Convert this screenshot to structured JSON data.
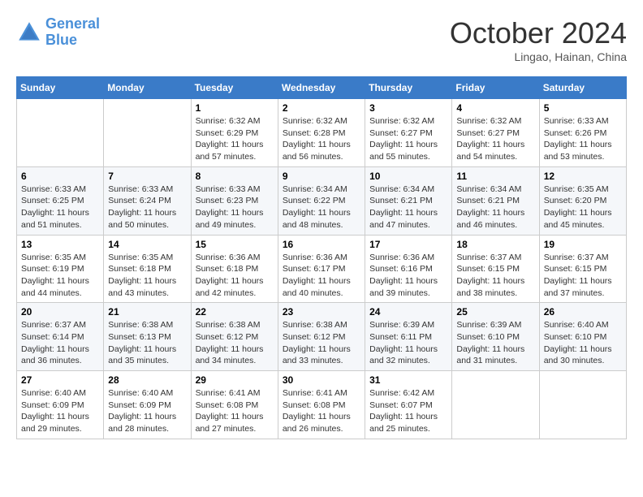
{
  "header": {
    "logo_line1": "General",
    "logo_line2": "Blue",
    "month": "October 2024",
    "location": "Lingao, Hainan, China"
  },
  "weekdays": [
    "Sunday",
    "Monday",
    "Tuesday",
    "Wednesday",
    "Thursday",
    "Friday",
    "Saturday"
  ],
  "weeks": [
    [
      {
        "day": "",
        "sunrise": "",
        "sunset": "",
        "daylight": ""
      },
      {
        "day": "",
        "sunrise": "",
        "sunset": "",
        "daylight": ""
      },
      {
        "day": "1",
        "sunrise": "Sunrise: 6:32 AM",
        "sunset": "Sunset: 6:29 PM",
        "daylight": "Daylight: 11 hours and 57 minutes."
      },
      {
        "day": "2",
        "sunrise": "Sunrise: 6:32 AM",
        "sunset": "Sunset: 6:28 PM",
        "daylight": "Daylight: 11 hours and 56 minutes."
      },
      {
        "day": "3",
        "sunrise": "Sunrise: 6:32 AM",
        "sunset": "Sunset: 6:27 PM",
        "daylight": "Daylight: 11 hours and 55 minutes."
      },
      {
        "day": "4",
        "sunrise": "Sunrise: 6:32 AM",
        "sunset": "Sunset: 6:27 PM",
        "daylight": "Daylight: 11 hours and 54 minutes."
      },
      {
        "day": "5",
        "sunrise": "Sunrise: 6:33 AM",
        "sunset": "Sunset: 6:26 PM",
        "daylight": "Daylight: 11 hours and 53 minutes."
      }
    ],
    [
      {
        "day": "6",
        "sunrise": "Sunrise: 6:33 AM",
        "sunset": "Sunset: 6:25 PM",
        "daylight": "Daylight: 11 hours and 51 minutes."
      },
      {
        "day": "7",
        "sunrise": "Sunrise: 6:33 AM",
        "sunset": "Sunset: 6:24 PM",
        "daylight": "Daylight: 11 hours and 50 minutes."
      },
      {
        "day": "8",
        "sunrise": "Sunrise: 6:33 AM",
        "sunset": "Sunset: 6:23 PM",
        "daylight": "Daylight: 11 hours and 49 minutes."
      },
      {
        "day": "9",
        "sunrise": "Sunrise: 6:34 AM",
        "sunset": "Sunset: 6:22 PM",
        "daylight": "Daylight: 11 hours and 48 minutes."
      },
      {
        "day": "10",
        "sunrise": "Sunrise: 6:34 AM",
        "sunset": "Sunset: 6:21 PM",
        "daylight": "Daylight: 11 hours and 47 minutes."
      },
      {
        "day": "11",
        "sunrise": "Sunrise: 6:34 AM",
        "sunset": "Sunset: 6:21 PM",
        "daylight": "Daylight: 11 hours and 46 minutes."
      },
      {
        "day": "12",
        "sunrise": "Sunrise: 6:35 AM",
        "sunset": "Sunset: 6:20 PM",
        "daylight": "Daylight: 11 hours and 45 minutes."
      }
    ],
    [
      {
        "day": "13",
        "sunrise": "Sunrise: 6:35 AM",
        "sunset": "Sunset: 6:19 PM",
        "daylight": "Daylight: 11 hours and 44 minutes."
      },
      {
        "day": "14",
        "sunrise": "Sunrise: 6:35 AM",
        "sunset": "Sunset: 6:18 PM",
        "daylight": "Daylight: 11 hours and 43 minutes."
      },
      {
        "day": "15",
        "sunrise": "Sunrise: 6:36 AM",
        "sunset": "Sunset: 6:18 PM",
        "daylight": "Daylight: 11 hours and 42 minutes."
      },
      {
        "day": "16",
        "sunrise": "Sunrise: 6:36 AM",
        "sunset": "Sunset: 6:17 PM",
        "daylight": "Daylight: 11 hours and 40 minutes."
      },
      {
        "day": "17",
        "sunrise": "Sunrise: 6:36 AM",
        "sunset": "Sunset: 6:16 PM",
        "daylight": "Daylight: 11 hours and 39 minutes."
      },
      {
        "day": "18",
        "sunrise": "Sunrise: 6:37 AM",
        "sunset": "Sunset: 6:15 PM",
        "daylight": "Daylight: 11 hours and 38 minutes."
      },
      {
        "day": "19",
        "sunrise": "Sunrise: 6:37 AM",
        "sunset": "Sunset: 6:15 PM",
        "daylight": "Daylight: 11 hours and 37 minutes."
      }
    ],
    [
      {
        "day": "20",
        "sunrise": "Sunrise: 6:37 AM",
        "sunset": "Sunset: 6:14 PM",
        "daylight": "Daylight: 11 hours and 36 minutes."
      },
      {
        "day": "21",
        "sunrise": "Sunrise: 6:38 AM",
        "sunset": "Sunset: 6:13 PM",
        "daylight": "Daylight: 11 hours and 35 minutes."
      },
      {
        "day": "22",
        "sunrise": "Sunrise: 6:38 AM",
        "sunset": "Sunset: 6:12 PM",
        "daylight": "Daylight: 11 hours and 34 minutes."
      },
      {
        "day": "23",
        "sunrise": "Sunrise: 6:38 AM",
        "sunset": "Sunset: 6:12 PM",
        "daylight": "Daylight: 11 hours and 33 minutes."
      },
      {
        "day": "24",
        "sunrise": "Sunrise: 6:39 AM",
        "sunset": "Sunset: 6:11 PM",
        "daylight": "Daylight: 11 hours and 32 minutes."
      },
      {
        "day": "25",
        "sunrise": "Sunrise: 6:39 AM",
        "sunset": "Sunset: 6:10 PM",
        "daylight": "Daylight: 11 hours and 31 minutes."
      },
      {
        "day": "26",
        "sunrise": "Sunrise: 6:40 AM",
        "sunset": "Sunset: 6:10 PM",
        "daylight": "Daylight: 11 hours and 30 minutes."
      }
    ],
    [
      {
        "day": "27",
        "sunrise": "Sunrise: 6:40 AM",
        "sunset": "Sunset: 6:09 PM",
        "daylight": "Daylight: 11 hours and 29 minutes."
      },
      {
        "day": "28",
        "sunrise": "Sunrise: 6:40 AM",
        "sunset": "Sunset: 6:09 PM",
        "daylight": "Daylight: 11 hours and 28 minutes."
      },
      {
        "day": "29",
        "sunrise": "Sunrise: 6:41 AM",
        "sunset": "Sunset: 6:08 PM",
        "daylight": "Daylight: 11 hours and 27 minutes."
      },
      {
        "day": "30",
        "sunrise": "Sunrise: 6:41 AM",
        "sunset": "Sunset: 6:08 PM",
        "daylight": "Daylight: 11 hours and 26 minutes."
      },
      {
        "day": "31",
        "sunrise": "Sunrise: 6:42 AM",
        "sunset": "Sunset: 6:07 PM",
        "daylight": "Daylight: 11 hours and 25 minutes."
      },
      {
        "day": "",
        "sunrise": "",
        "sunset": "",
        "daylight": ""
      },
      {
        "day": "",
        "sunrise": "",
        "sunset": "",
        "daylight": ""
      }
    ]
  ]
}
